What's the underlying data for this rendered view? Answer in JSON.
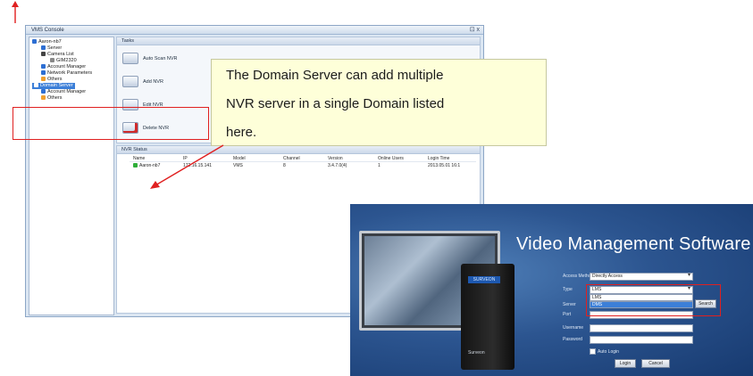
{
  "console": {
    "title": "VMS Console",
    "window_controls": "⊡ x",
    "tree": [
      {
        "label": "Aaron-nb7",
        "icon": "domain-icon",
        "color": "#2e6fd3"
      },
      {
        "label": "Server",
        "icon": "server-icon",
        "color": "#2e6fd3"
      },
      {
        "label": "Camera List",
        "icon": "camera-list-icon",
        "color": "#444444"
      },
      {
        "label": "GIM2320",
        "icon": "camera-icon",
        "color": "#888888"
      },
      {
        "label": "Account Manager",
        "icon": "account-icon",
        "color": "#2e6fd3"
      },
      {
        "label": "Network Parameters",
        "icon": "network-icon",
        "color": "#2e6fd3"
      },
      {
        "label": "Others",
        "icon": "others-icon",
        "color": "#f0a030"
      },
      {
        "label": "Domain Server",
        "icon": "domain-server-icon",
        "color": "#2e6fd3"
      },
      {
        "label": "Account Manager",
        "icon": "account-icon",
        "color": "#2e6fd3"
      },
      {
        "label": "Others",
        "icon": "others-icon",
        "color": "#f0a030"
      }
    ],
    "tasks_header": "Tasks",
    "tasks": [
      "Auto Scan NVR",
      "Add NVR",
      "Edit NVR",
      "Delete NVR"
    ],
    "status_header": "NVR Status",
    "status_columns": [
      "Name",
      "IP",
      "Model",
      "Channel",
      "Version",
      "Online Users",
      "Login Time"
    ],
    "status_rows": [
      [
        "Aaron-nb7",
        "172.16.15.141",
        "VMS",
        "8",
        "3.4.7.0(4)",
        "1",
        "2013.05.01 16:1"
      ]
    ]
  },
  "callout": {
    "lines": [
      "The Domain Server can add multiple",
      "NVR server in a single Domain listed",
      "here."
    ]
  },
  "vms": {
    "title": "Video Management Software",
    "access_method_label": "Access Method",
    "access_method_value": "Directly Access",
    "type_label": "Type",
    "type_options": [
      "LMS",
      "DMS"
    ],
    "server_label": "Server",
    "search_button": "Search",
    "port_label": "Port",
    "username_label": "Username",
    "password_label": "Password",
    "auto_login_label": "Auto Login",
    "login_button": "Login",
    "cancel_button": "Cancel",
    "device_brand": "Surveon",
    "device_lcd": "SURVEON"
  },
  "colors": {
    "highlight_red": "#e02020",
    "callout_bg": "#feffd9",
    "vms_bg": "#2c5590"
  }
}
